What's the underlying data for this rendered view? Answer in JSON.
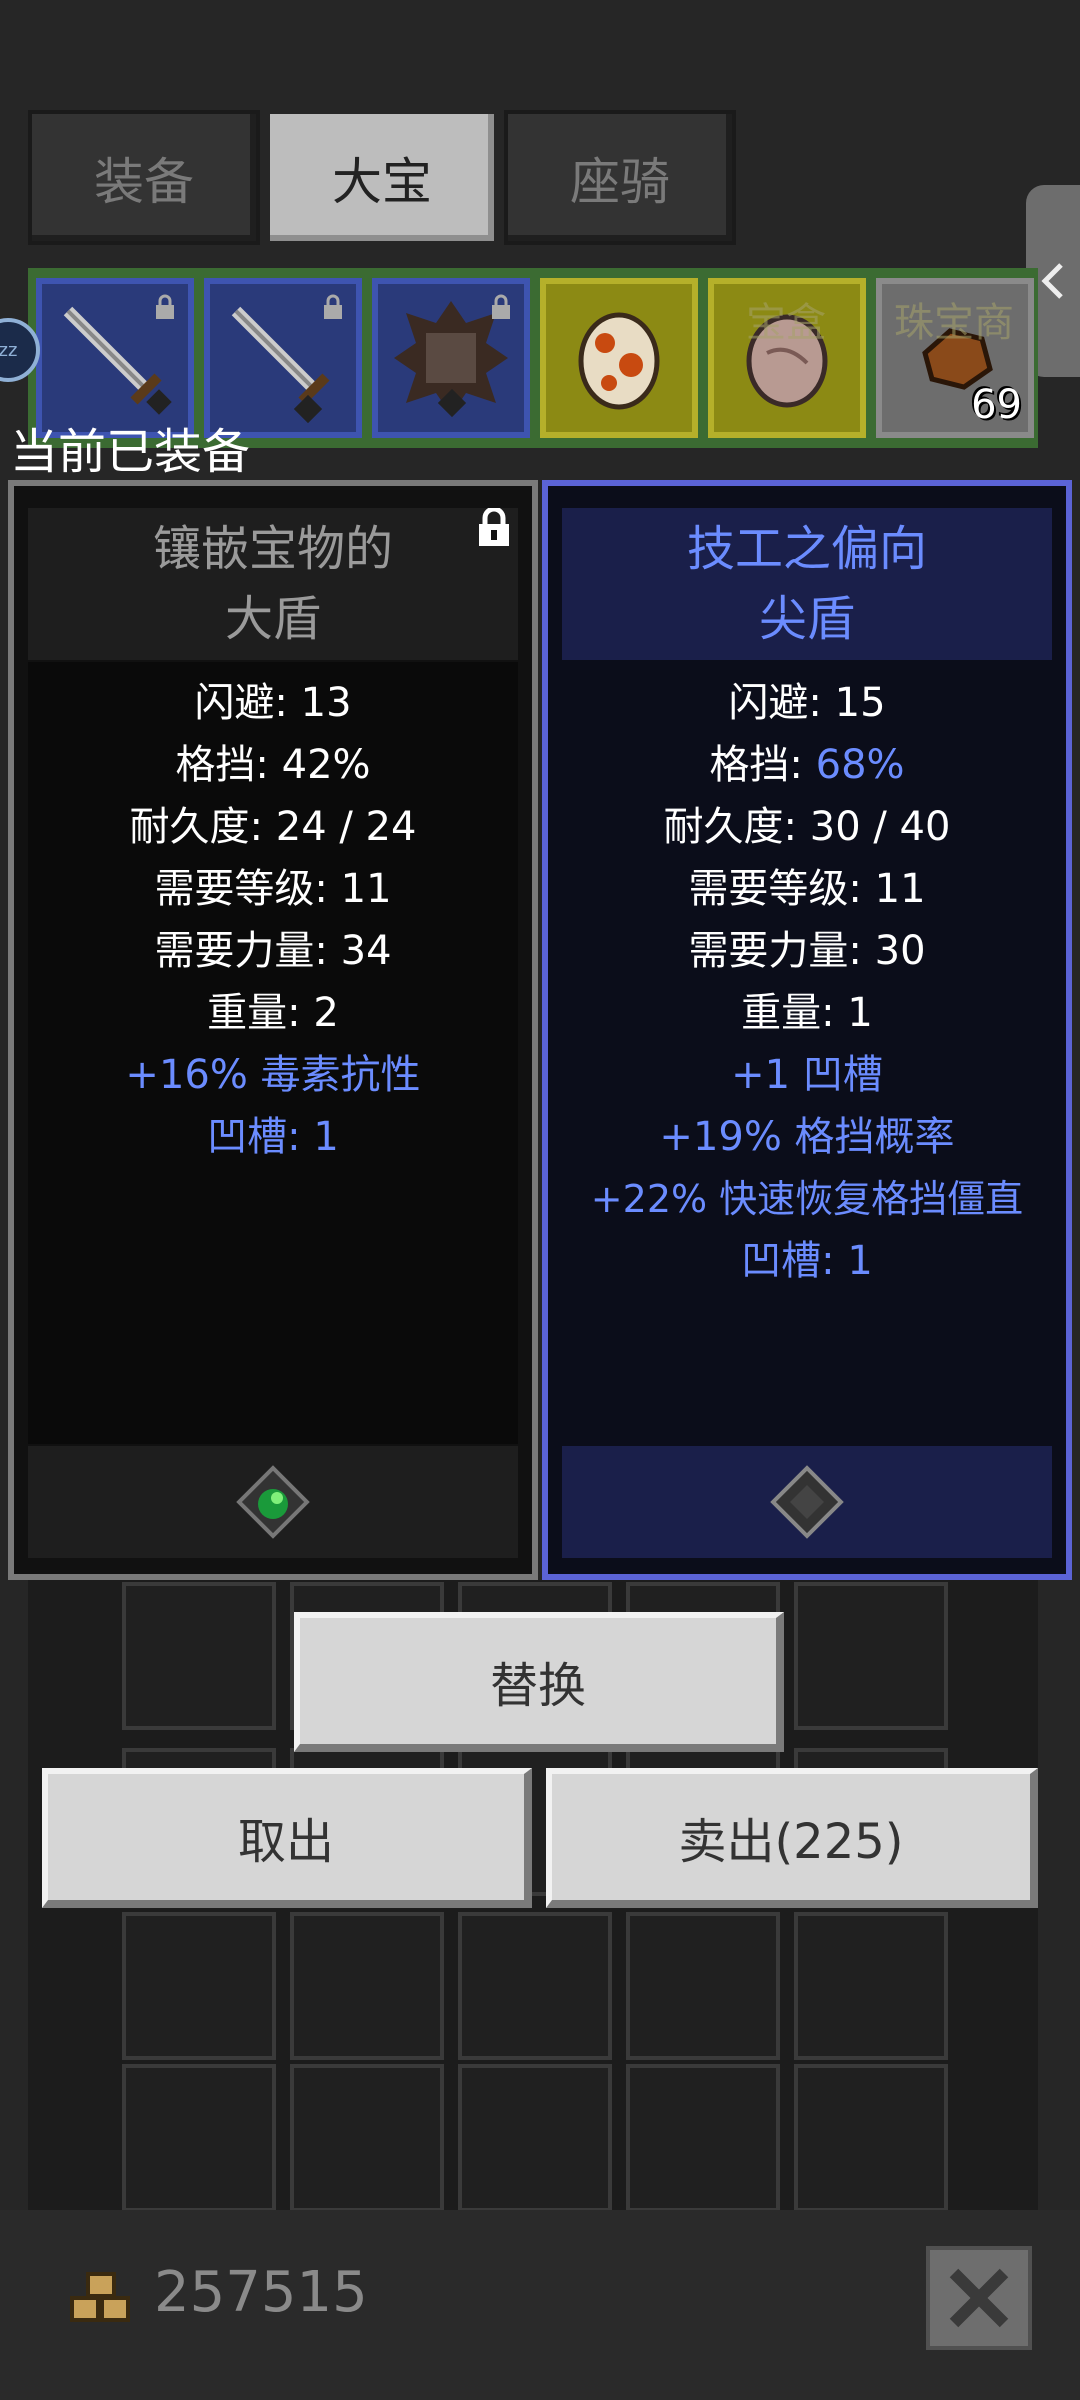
{
  "tabs": [
    {
      "label": "装备",
      "active": false
    },
    {
      "label": "大宝",
      "active": true
    },
    {
      "label": "座骑",
      "active": false
    }
  ],
  "side_handle": {
    "icon": "chevron-left-icon"
  },
  "inventory": {
    "faded_labels": [
      "宝盒",
      "珠宝商"
    ],
    "sleep_badge": "zz",
    "slots": [
      {
        "item": "sword-icon",
        "locked": true,
        "color": "blue"
      },
      {
        "item": "sword-icon",
        "locked": true,
        "color": "blue"
      },
      {
        "item": "spiked-shield-icon",
        "locked": true,
        "color": "blue"
      },
      {
        "item": "spotted-egg-icon",
        "locked": false,
        "color": "yellow"
      },
      {
        "item": "stone-egg-icon",
        "locked": false,
        "color": "yellow"
      },
      {
        "item": "ore-chunk-icon",
        "locked": false,
        "color": "grey",
        "count": "69"
      }
    ]
  },
  "equipped_label": "当前已装备",
  "left_panel": {
    "title_line1": "镶嵌宝物的",
    "title_line2": "大盾",
    "locked": true,
    "stats": [
      {
        "label": "闪避: ",
        "value": "13"
      },
      {
        "label": "格挡: ",
        "value": "42%"
      },
      {
        "label": "耐久度: ",
        "value": "24 / 24"
      },
      {
        "label": "需要等级: ",
        "value": "11"
      },
      {
        "label": "需要力量: ",
        "value": "34"
      },
      {
        "label": "重量: ",
        "value": "2"
      }
    ],
    "affixes": [
      "+16% 毒素抗性",
      "凹槽: 1"
    ],
    "socket_icon": "green-gem-socket-icon"
  },
  "right_panel": {
    "title_line1": "技工之偏向",
    "title_line2": "尖盾",
    "stats": [
      {
        "label": "闪避: ",
        "value": "15"
      },
      {
        "label": "格挡: ",
        "value": "68%"
      },
      {
        "label": "耐久度: ",
        "value": "30 / 40"
      },
      {
        "label": "需要等级: ",
        "value": "11"
      },
      {
        "label": "需要力量: ",
        "value": "30"
      },
      {
        "label": "重量: ",
        "value": "1"
      }
    ],
    "affixes": [
      "+1 凹槽",
      "+19% 格挡概率",
      "+22% 快速恢复格挡僵直",
      "凹槽: 1"
    ],
    "socket_icon": "empty-socket-icon"
  },
  "buttons": {
    "replace": "替换",
    "take_out": "取出",
    "sell": "卖出(225)"
  },
  "footer": {
    "gold_icon": "gold-coins-icon",
    "gold_amount": "257515",
    "close_icon": "close-icon"
  },
  "colors": {
    "accent_blue": "#6b8cff",
    "panel_border_blue": "#5b63d6",
    "tab_active": "#bdbdbd"
  }
}
